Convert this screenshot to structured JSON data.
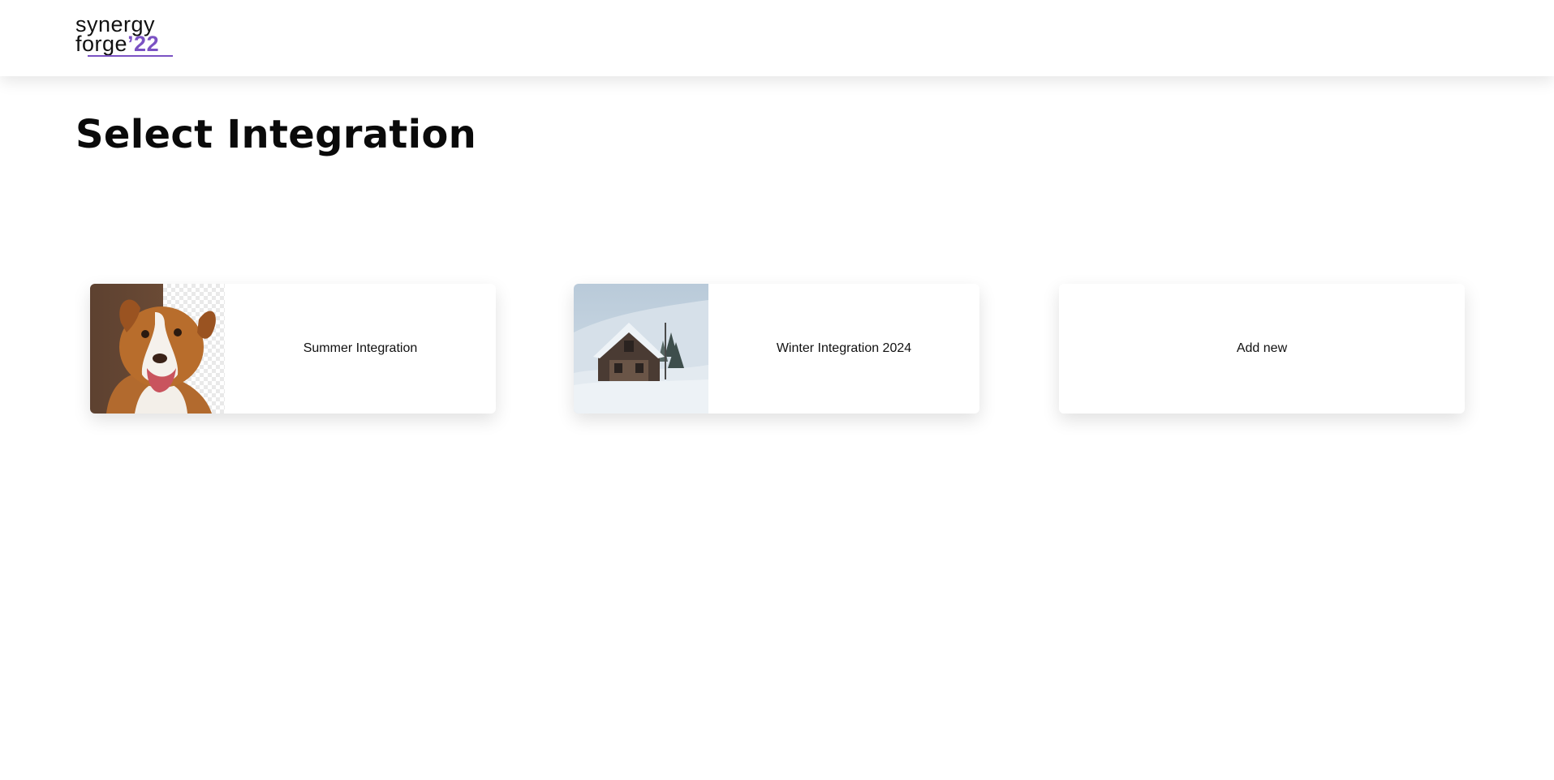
{
  "app": {
    "logo": {
      "line1": "synergy",
      "line2_prefix": "forge",
      "line2_accent": "’22"
    }
  },
  "main": {
    "title": "Select Integration",
    "cards": [
      {
        "label": "Summer Integration",
        "image": "dog-photo"
      },
      {
        "label": "Winter Integration 2024",
        "image": "snowy-cabin-photo"
      },
      {
        "label": "Add new",
        "image": ""
      }
    ]
  },
  "colors": {
    "accent": "#7b52c3",
    "background": "#ffffff",
    "text": "#111111"
  }
}
